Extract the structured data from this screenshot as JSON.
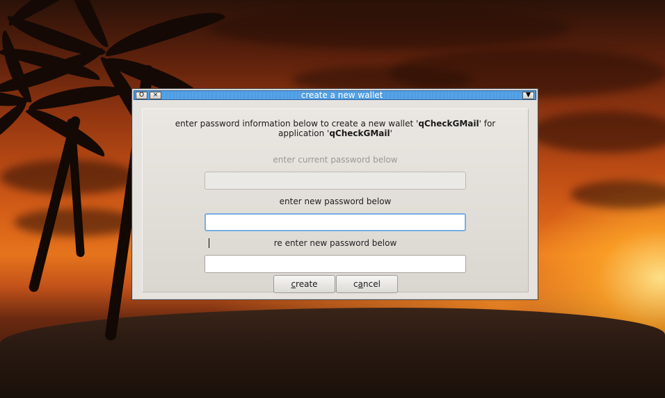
{
  "window": {
    "title": "create a new wallet",
    "menu_button": "O",
    "close_button": "×",
    "shade_button": "▼"
  },
  "dialog": {
    "message_prefix": "enter password information below to create a new wallet '",
    "wallet_name": "qCheckGMail",
    "message_middle": "' for",
    "message_line2_prefix": "application '",
    "application_name": "qCheckGMail",
    "message_line2_suffix": "'",
    "current_password_label": "enter current password below",
    "current_password_value": "",
    "new_password_label": "enter new password below",
    "new_password_value": "",
    "reenter_password_label": "re enter new password below",
    "reenter_password_value": "",
    "create_button_mnemonic": "c",
    "create_button_rest": "reate",
    "cancel_button_first": "c",
    "cancel_button_mnemonic": "a",
    "cancel_button_rest": "ncel"
  },
  "colors": {
    "titlebar_accent": "#4f9fe4",
    "focus_ring": "#76aee4",
    "dialog_bg": "#e6e3de",
    "disabled_text": "#9a9893"
  }
}
